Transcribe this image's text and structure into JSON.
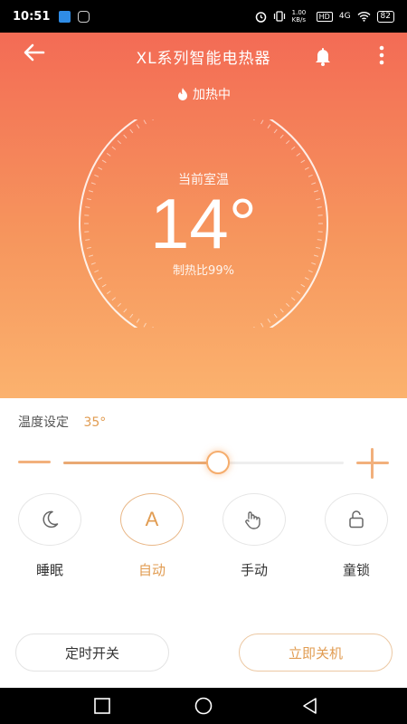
{
  "status_bar": {
    "time": "10:51",
    "net_speed": "1.00 KB/s",
    "hd": "HD",
    "network": "4G",
    "battery": "82"
  },
  "header": {
    "title": "XL系列智能电热器",
    "back_icon": "arrow-left-icon",
    "bell_icon": "bell-icon",
    "more_icon": "more-vertical-icon"
  },
  "heat_status": {
    "label": "加热中",
    "icon": "flame-icon"
  },
  "dial": {
    "room_label": "当前室温",
    "temperature": "14°",
    "ratio_label": "制热比99%"
  },
  "setting": {
    "label": "温度设定",
    "value": "35°",
    "slider_fraction": 0.55
  },
  "modes": [
    {
      "label": "睡眠",
      "icon": "moon-icon",
      "active": false
    },
    {
      "label": "自动",
      "icon": "auto-icon",
      "letter": "A",
      "active": true
    },
    {
      "label": "手动",
      "icon": "hand-pointer-icon",
      "active": false
    },
    {
      "label": "童锁",
      "icon": "lock-icon",
      "active": false
    }
  ],
  "buttons": {
    "timer": "定时开关",
    "power_off": "立即关机"
  },
  "nav_bar": {
    "recents": "square-icon",
    "home": "circle-icon",
    "back": "triangle-back-icon"
  },
  "colors": {
    "hero_top": "#f36b55",
    "hero_bottom": "#fbb26e",
    "accent": "#e19c52"
  }
}
